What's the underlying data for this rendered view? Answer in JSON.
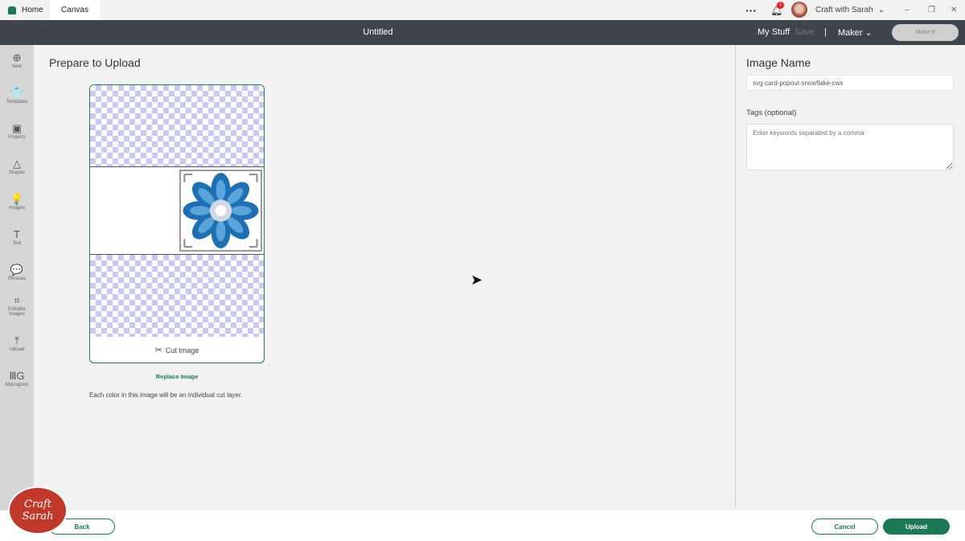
{
  "tabs": {
    "home": "Home",
    "canvas": "Canvas"
  },
  "topbar": {
    "notification_count": "1",
    "user": "Craft with Sarah"
  },
  "header": {
    "title": "Untitled",
    "my_stuff": "My Stuff",
    "save": "Save",
    "separator": "|",
    "machine": "Maker",
    "make_it": "Make It"
  },
  "sidebar": {
    "items": [
      {
        "label": "New",
        "icon": "⊕"
      },
      {
        "label": "Templates",
        "icon": "👕"
      },
      {
        "label": "Projects",
        "icon": "▣"
      },
      {
        "label": "Shapes",
        "icon": "△"
      },
      {
        "label": "Images",
        "icon": "💡"
      },
      {
        "label": "Text",
        "icon": "T"
      },
      {
        "label": "Phrases",
        "icon": "💬"
      },
      {
        "label": "Editable Images",
        "icon": "⌗"
      },
      {
        "label": "Upload",
        "icon": "⤒"
      },
      {
        "label": "Monogram",
        "icon": "ⅢG"
      }
    ]
  },
  "main": {
    "title": "Prepare to Upload",
    "cut_label": "Cut Image",
    "replace": "Replace Image",
    "note": "Each color in this image will be an individual cut layer."
  },
  "panel": {
    "name_label": "Image Name",
    "name_value": "svg-card-popout-snowflake-cws",
    "tags_label": "Tags (optional)",
    "tags_placeholder": "Enter keywords separated by a comma"
  },
  "footer": {
    "back": "Back",
    "cancel": "Cancel",
    "upload": "Upload"
  },
  "logo": {
    "text": "Craft with Sarah"
  },
  "colors": {
    "accent": "#1b7a55",
    "header": "#3f434a"
  }
}
